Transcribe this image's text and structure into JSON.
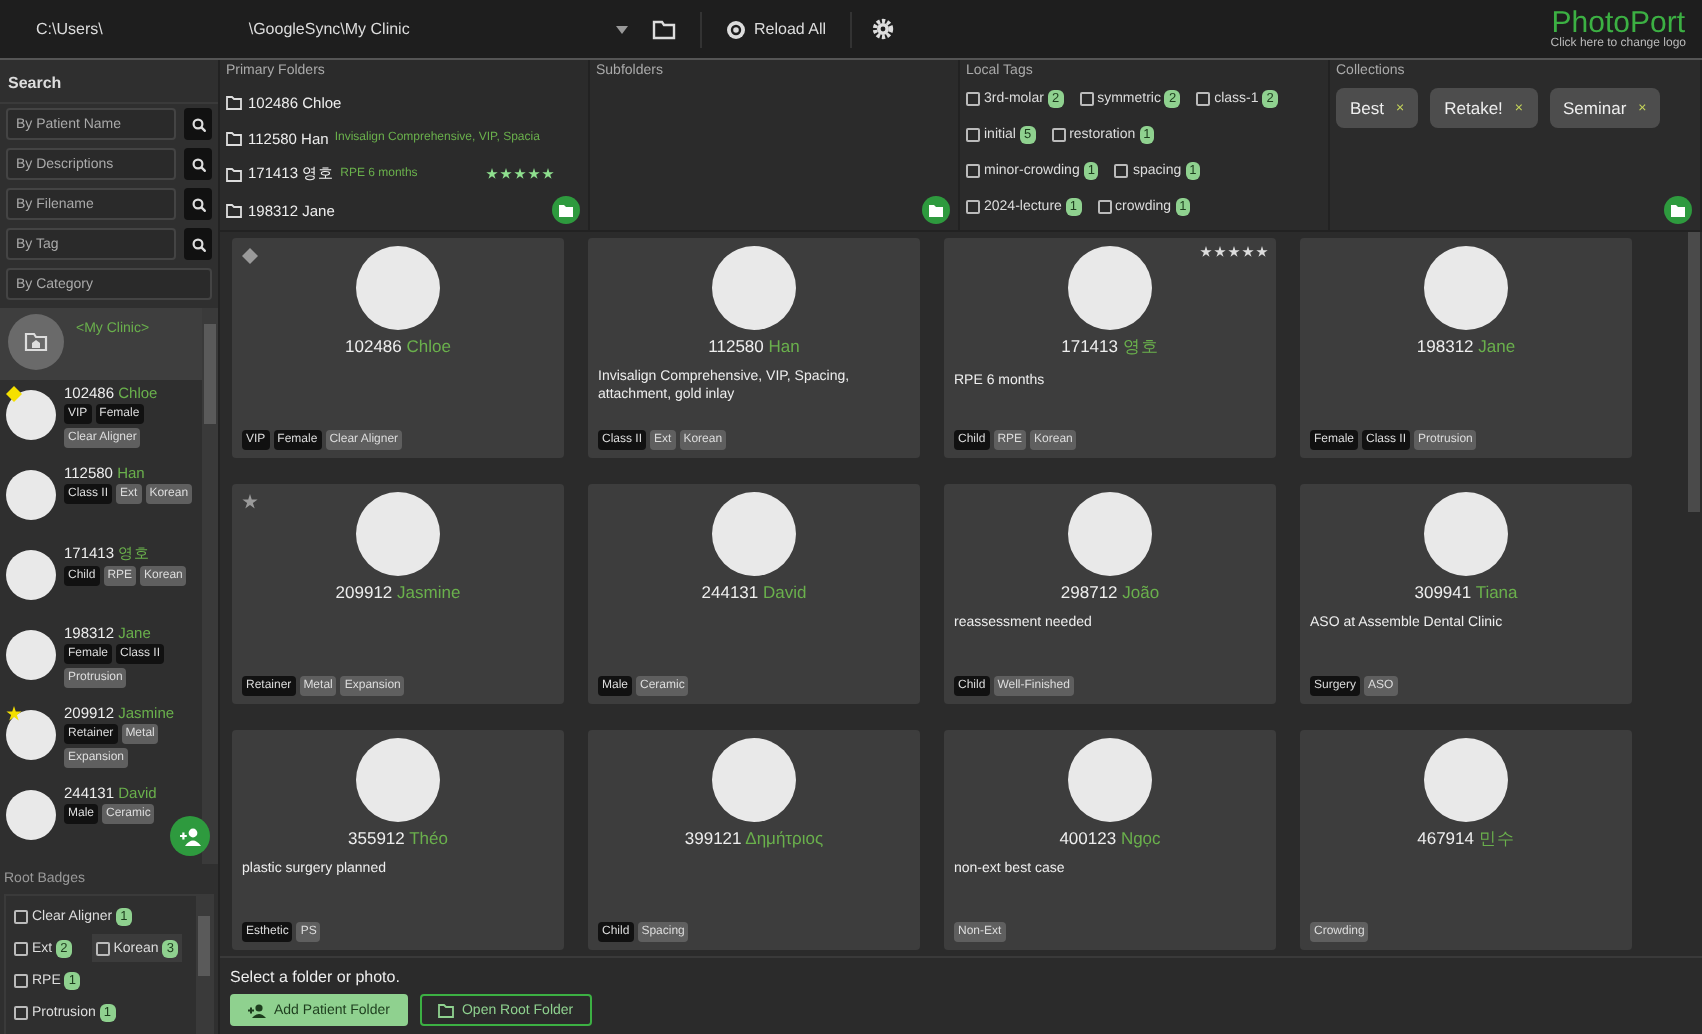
{
  "top_bar": {
    "path_start": "C:\\Users\\",
    "path_end": "\\GoogleSync\\My Clinic",
    "reload_button": "Reload All",
    "logo": {
      "title": "PhotoPort",
      "subtitle": "Click here to change logo"
    }
  },
  "search": {
    "title": "Search",
    "fields": [
      {
        "placeholder": "By Patient Name"
      },
      {
        "placeholder": "By Descriptions"
      },
      {
        "placeholder": "By Filename"
      },
      {
        "placeholder": "By Tag"
      }
    ],
    "category": {
      "placeholder": "By Category"
    }
  },
  "patient_list": {
    "root": "<My Clinic>",
    "patients": [
      {
        "id": "102486",
        "name": "Chloe",
        "pinned": true,
        "favorite": false,
        "tags": [
          {
            "label": "VIP",
            "kind": "dark"
          },
          {
            "label": "Female",
            "kind": "dark"
          },
          {
            "label": "Clear Aligner",
            "kind": "muted"
          }
        ]
      },
      {
        "id": "112580",
        "name": "Han",
        "pinned": false,
        "favorite": false,
        "tags": [
          {
            "label": "Class II",
            "kind": "dark"
          },
          {
            "label": "Ext",
            "kind": "muted"
          },
          {
            "label": "Korean",
            "kind": "muted"
          }
        ]
      },
      {
        "id": "171413",
        "name": "영호",
        "pinned": false,
        "favorite": false,
        "tags": [
          {
            "label": "Child",
            "kind": "dark"
          },
          {
            "label": "RPE",
            "kind": "muted"
          },
          {
            "label": "Korean",
            "kind": "muted"
          }
        ]
      },
      {
        "id": "198312",
        "name": "Jane",
        "pinned": false,
        "favorite": false,
        "tags": [
          {
            "label": "Female",
            "kind": "dark"
          },
          {
            "label": "Class II",
            "kind": "dark"
          },
          {
            "label": "Protrusion",
            "kind": "muted"
          }
        ]
      },
      {
        "id": "209912",
        "name": "Jasmine",
        "pinned": false,
        "favorite": true,
        "tags": [
          {
            "label": "Retainer",
            "kind": "dark"
          },
          {
            "label": "Metal",
            "kind": "muted"
          },
          {
            "label": "Expansion",
            "kind": "muted"
          }
        ]
      },
      {
        "id": "244131",
        "name": "David",
        "pinned": false,
        "favorite": false,
        "tags": [
          {
            "label": "Male",
            "kind": "dark"
          },
          {
            "label": "Ceramic",
            "kind": "muted"
          }
        ]
      }
    ]
  },
  "root_badges": {
    "title": "Root Badges",
    "items": [
      {
        "label": "Clear Aligner",
        "count": "1",
        "checked": false,
        "hovered": false
      },
      {
        "label": "Ext",
        "count": "2",
        "checked": false,
        "hovered": false
      },
      {
        "label": "Korean",
        "count": "3",
        "checked": false,
        "hovered": true
      },
      {
        "label": "RPE",
        "count": "1",
        "checked": false,
        "hovered": false
      },
      {
        "label": "Protrusion",
        "count": "1",
        "checked": false,
        "hovered": false
      }
    ]
  },
  "primary_folders": {
    "title": "Primary Folders",
    "items": [
      {
        "id": "102486",
        "name": "Chloe"
      },
      {
        "id": "112580",
        "name": "Han",
        "note": "Invisalign Comprehensive, VIP, Spacia"
      },
      {
        "id": "171413",
        "name": "영호",
        "note": "RPE 6 months",
        "stars": 5
      },
      {
        "id": "198312",
        "name": "Jane"
      }
    ]
  },
  "subfolders": {
    "title": "Subfolders"
  },
  "local_tags": {
    "title": "Local Tags",
    "items": [
      {
        "label": "3rd-molar",
        "count": "2",
        "checked": false
      },
      {
        "label": "symmetric",
        "count": "2",
        "checked": false
      },
      {
        "label": "class-1",
        "count": "2",
        "checked": false
      },
      {
        "label": "initial",
        "count": "5",
        "checked": false
      },
      {
        "label": "restoration",
        "count": "1",
        "checked": false
      },
      {
        "label": "minor-crowding",
        "count": "1",
        "checked": false
      },
      {
        "label": "spacing",
        "count": "1",
        "checked": false
      },
      {
        "label": "2024-lecture",
        "count": "1",
        "checked": false
      },
      {
        "label": "crowding",
        "count": "1",
        "checked": false
      }
    ]
  },
  "collections": {
    "title": "Collections",
    "items": [
      {
        "label": "Best",
        "remove": "×"
      },
      {
        "label": "Retake!",
        "remove": "×"
      },
      {
        "label": "Seminar",
        "remove": "×"
      }
    ]
  },
  "cards": [
    {
      "id": "102486",
      "name": "Chloe",
      "pinned": true,
      "favorite": false,
      "tags": [
        {
          "label": "VIP",
          "kind": "dark"
        },
        {
          "label": "Female",
          "kind": "dark"
        },
        {
          "label": "Clear Aligner",
          "kind": "muted"
        }
      ]
    },
    {
      "id": "112580",
      "name": "Han",
      "pinned": false,
      "favorite": false,
      "description": "Invisalign Comprehensive, VIP, Spacing, attachment, gold inlay",
      "tags": [
        {
          "label": "Class II",
          "kind": "dark"
        },
        {
          "label": "Ext",
          "kind": "muted"
        },
        {
          "label": "Korean",
          "kind": "muted"
        }
      ]
    },
    {
      "id": "171413",
      "name": "영호",
      "pinned": false,
      "favorite": false,
      "stars": 5,
      "description": "RPE 6 months",
      "tags": [
        {
          "label": "Child",
          "kind": "dark"
        },
        {
          "label": "RPE",
          "kind": "muted"
        },
        {
          "label": "Korean",
          "kind": "muted"
        }
      ]
    },
    {
      "id": "198312",
      "name": "Jane",
      "pinned": false,
      "favorite": false,
      "tags": [
        {
          "label": "Female",
          "kind": "dark"
        },
        {
          "label": "Class II",
          "kind": "dark"
        },
        {
          "label": "Protrusion",
          "kind": "muted"
        }
      ]
    },
    {
      "id": "209912",
      "name": "Jasmine",
      "pinned": false,
      "favorite": true,
      "tags": [
        {
          "label": "Retainer",
          "kind": "dark"
        },
        {
          "label": "Metal",
          "kind": "muted"
        },
        {
          "label": "Expansion",
          "kind": "muted"
        }
      ]
    },
    {
      "id": "244131",
      "name": "David",
      "pinned": false,
      "favorite": false,
      "tags": [
        {
          "label": "Male",
          "kind": "dark"
        },
        {
          "label": "Ceramic",
          "kind": "muted"
        }
      ]
    },
    {
      "id": "298712",
      "name": "João",
      "pinned": false,
      "favorite": false,
      "description": "reassessment needed",
      "tags": [
        {
          "label": "Child",
          "kind": "dark"
        },
        {
          "label": "Well-Finished",
          "kind": "muted"
        }
      ]
    },
    {
      "id": "309941",
      "name": "Tiana",
      "pinned": false,
      "favorite": false,
      "description": "ASO at Assemble Dental Clinic",
      "tags": [
        {
          "label": "Surgery",
          "kind": "dark"
        },
        {
          "label": "ASO",
          "kind": "muted"
        }
      ]
    },
    {
      "id": "355912",
      "name": "Théo",
      "pinned": false,
      "favorite": false,
      "description": "plastic surgery planned",
      "tags": [
        {
          "label": "Esthetic",
          "kind": "dark"
        },
        {
          "label": "PS",
          "kind": "muted"
        }
      ]
    },
    {
      "id": "399121",
      "name": "Δημήτριος",
      "pinned": false,
      "favorite": false,
      "tags": [
        {
          "label": "Child",
          "kind": "dark"
        },
        {
          "label": "Spacing",
          "kind": "muted"
        }
      ]
    },
    {
      "id": "400123",
      "name": "Ngọc",
      "pinned": false,
      "favorite": false,
      "description": "non-ext best case",
      "tags": [
        {
          "label": "Non-Ext",
          "kind": "muted"
        }
      ]
    },
    {
      "id": "467914",
      "name": "민수",
      "pinned": false,
      "favorite": false,
      "tags": [
        {
          "label": "Crowding",
          "kind": "muted"
        }
      ]
    }
  ],
  "status_bar": {
    "message": "Select a folder or photo.",
    "buttons": [
      {
        "label": "Add Patient Folder",
        "kind": "filled"
      },
      {
        "label": "Open Root Folder",
        "kind": "outline"
      }
    ]
  }
}
